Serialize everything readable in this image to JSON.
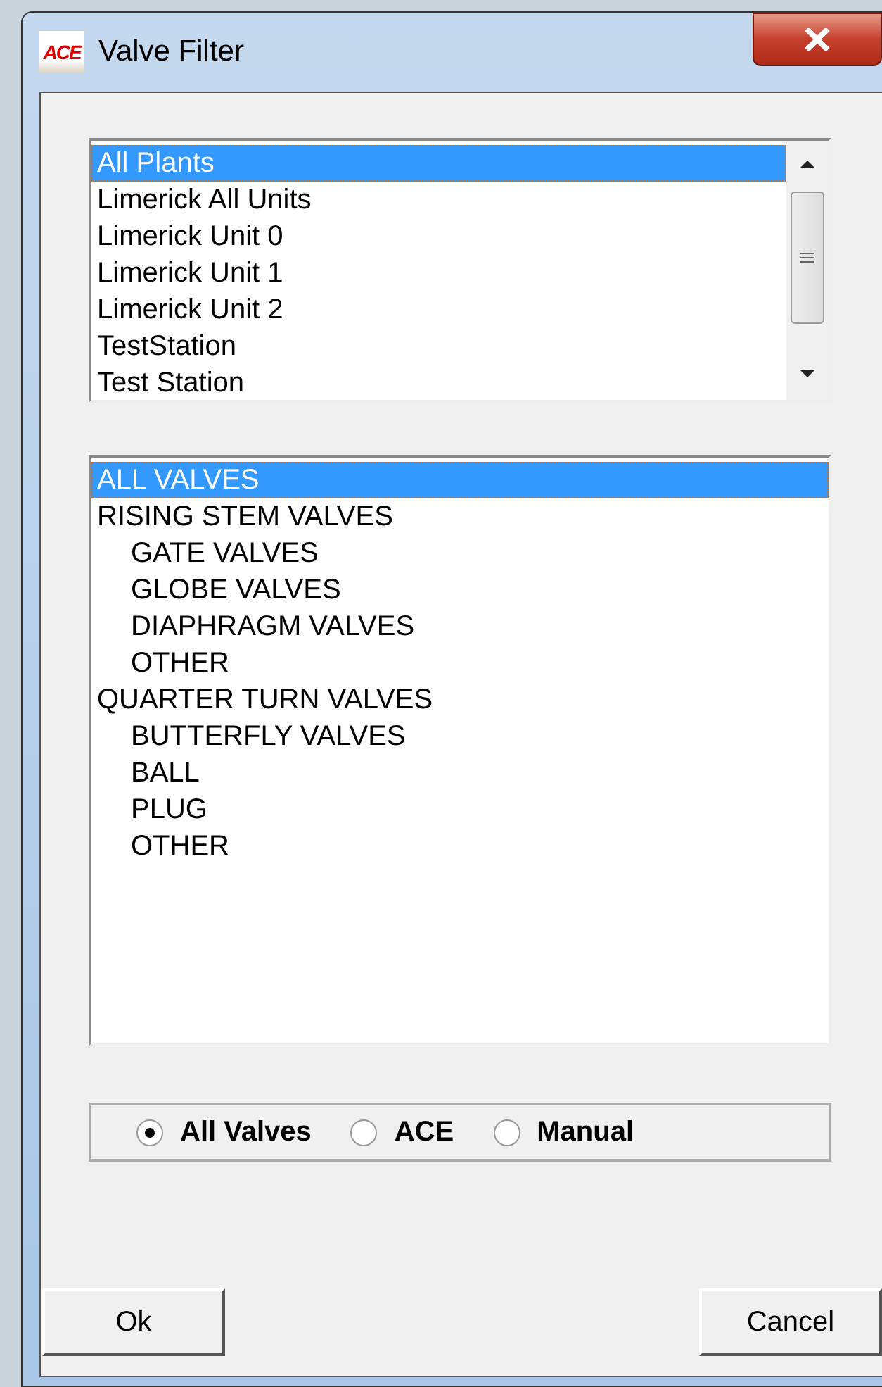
{
  "window": {
    "title": "Valve Filter",
    "logo_text": "ACE"
  },
  "plants": [
    {
      "label": "All Plants",
      "selected": true
    },
    {
      "label": "Limerick All Units",
      "selected": false
    },
    {
      "label": "Limerick Unit 0",
      "selected": false
    },
    {
      "label": "Limerick Unit 1",
      "selected": false
    },
    {
      "label": "Limerick Unit 2",
      "selected": false
    },
    {
      "label": "TestStation",
      "selected": false
    },
    {
      "label": "Test Station",
      "selected": false
    }
  ],
  "valve_types": [
    {
      "label": "ALL VALVES",
      "selected": true
    },
    {
      "label": "RISING STEM VALVES",
      "selected": false,
      "children": [
        {
          "label": "GATE VALVES",
          "selected": false
        },
        {
          "label": "GLOBE VALVES",
          "selected": false
        },
        {
          "label": "DIAPHRAGM VALVES",
          "selected": false
        },
        {
          "label": "OTHER",
          "selected": false
        }
      ]
    },
    {
      "label": "QUARTER TURN VALVES",
      "selected": false,
      "children": [
        {
          "label": "BUTTERFLY VALVES",
          "selected": false
        },
        {
          "label": "BALL",
          "selected": false
        },
        {
          "label": "PLUG",
          "selected": false
        },
        {
          "label": "OTHER",
          "selected": false
        }
      ]
    }
  ],
  "source": [
    {
      "label": "All Valves",
      "selected": true
    },
    {
      "label": "ACE",
      "selected": false
    },
    {
      "label": "Manual",
      "selected": false
    }
  ],
  "buttons": [
    "Ok",
    "Cancel"
  ]
}
